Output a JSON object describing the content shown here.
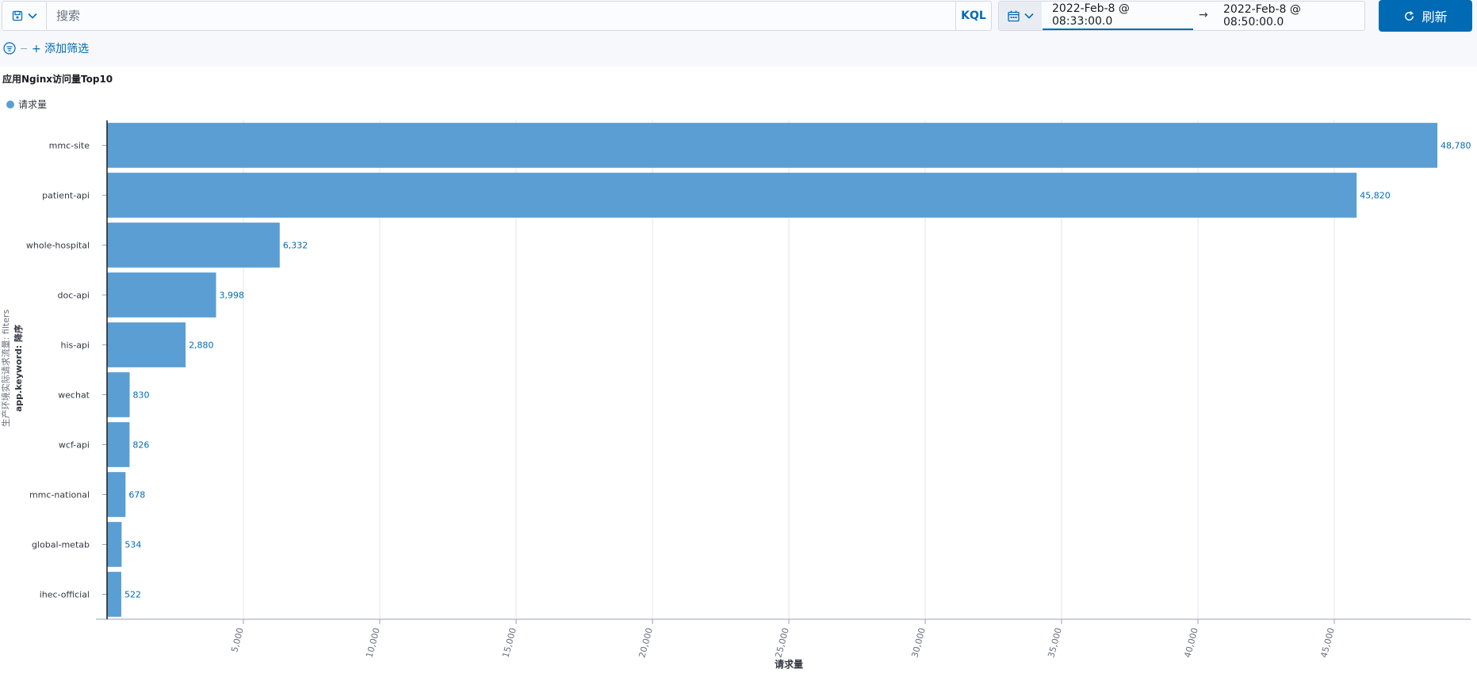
{
  "query_bar": {
    "placeholder": "搜索",
    "language": "KQL",
    "saved_query_icon": "save-icon",
    "chevron_icon": "chevron-down-icon"
  },
  "time_picker": {
    "icon": "calendar-icon",
    "start": "2022-Feb-8 @ 08:33:00.0",
    "arrow": "→",
    "end": "2022-Feb-8 @ 08:50:00.0"
  },
  "refresh": {
    "label": "刷新",
    "icon": "refresh-icon"
  },
  "filters": {
    "icon": "filter-icon",
    "add_label": "+ 添加筛选"
  },
  "colors": {
    "accent": "#006bb4",
    "bar": "#5a9ed4",
    "grid": "#e3e6eb"
  },
  "chart_data": {
    "type": "bar",
    "orientation": "horizontal",
    "title": "应用Nginx访问量Top10",
    "ylabel_line1": "生产环境实际请求流量: filters",
    "ylabel_line2": "app.keyword: 降序",
    "xlabel": "请求量",
    "legend": [
      "请求量"
    ],
    "legend_position": "top-left",
    "categories": [
      "mmc-site",
      "patient-api",
      "whole-hospital",
      "doc-api",
      "his-api",
      "wechat",
      "wcf-api",
      "mmc-national",
      "global-metab",
      "ihec-official"
    ],
    "series": [
      {
        "name": "请求量",
        "values": [
          48780,
          45820,
          6332,
          3998,
          2880,
          830,
          826,
          678,
          534,
          522
        ]
      }
    ],
    "value_labels": [
      "48,780",
      "45,820",
      "6,332",
      "3,998",
      "2,880",
      "830",
      "826",
      "678",
      "534",
      "522"
    ],
    "x_ticks": [
      5000,
      10000,
      15000,
      20000,
      25000,
      30000,
      35000,
      40000,
      45000
    ],
    "x_tick_labels": [
      "5,000",
      "10,000",
      "15,000",
      "20,000",
      "25,000",
      "30,000",
      "35,000",
      "40,000",
      "45,000"
    ],
    "xlim": [
      0,
      50000
    ],
    "grid": true
  }
}
